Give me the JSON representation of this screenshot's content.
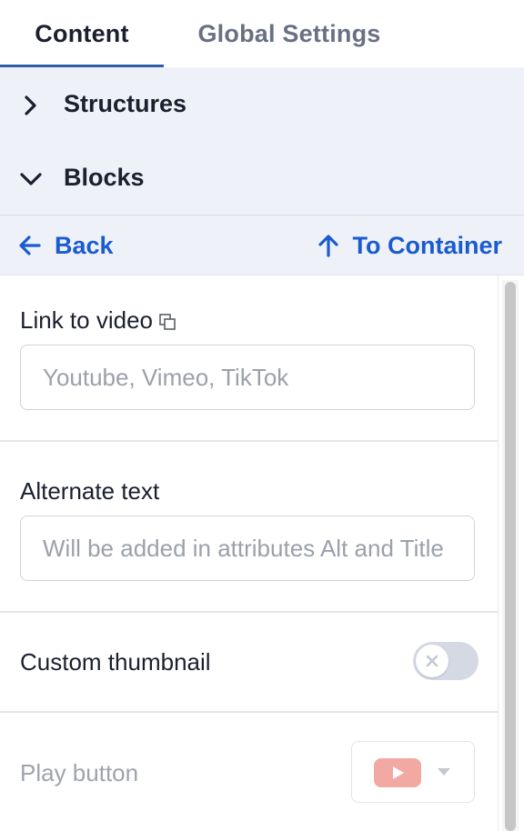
{
  "tabs": [
    {
      "label": "Content",
      "active": true
    },
    {
      "label": "Global Settings",
      "active": false
    }
  ],
  "sections": {
    "structures": {
      "label": "Structures",
      "expanded": false,
      "icon": "chevron-right-icon"
    },
    "blocks": {
      "label": "Blocks",
      "expanded": true,
      "icon": "chevron-down-icon"
    }
  },
  "nav": {
    "back_label": "Back",
    "back_icon": "arrow-left-icon",
    "container_label": "To Container",
    "container_icon": "arrow-up-icon"
  },
  "fields": {
    "video_link": {
      "label": "Link to video",
      "value": "",
      "placeholder": "Youtube, Vimeo, TikTok",
      "icon": "copy-icon"
    },
    "alt_text": {
      "label": "Alternate text",
      "value": "",
      "placeholder": "Will be added in attributes Alt and Title"
    },
    "custom_thumbnail": {
      "label": "Custom thumbnail",
      "enabled": false
    },
    "play_button": {
      "label": "Play button",
      "selected_icon": "youtube-play-icon"
    }
  },
  "colors": {
    "accent": "#1a5bd0",
    "tab_underline": "#2d5fa8",
    "section_bg": "#eef2f8",
    "play_button_bg": "#f2a9a4"
  }
}
